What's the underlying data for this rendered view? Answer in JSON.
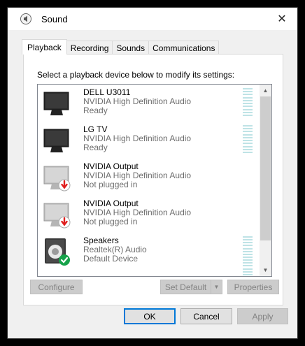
{
  "window": {
    "title": "Sound",
    "close_glyph": "✕"
  },
  "tabs": [
    {
      "label": "Playback",
      "active": true
    },
    {
      "label": "Recording"
    },
    {
      "label": "Sounds"
    },
    {
      "label": "Communications"
    }
  ],
  "instruction": "Select a playback device below to modify its settings:",
  "devices": [
    {
      "name": "DELL U3011",
      "driver": "NVIDIA High Definition Audio",
      "status": "Ready",
      "icon": "monitor-icon",
      "badge": ""
    },
    {
      "name": "LG TV",
      "driver": "NVIDIA High Definition Audio",
      "status": "Ready",
      "icon": "monitor-icon",
      "badge": ""
    },
    {
      "name": "NVIDIA Output",
      "driver": "NVIDIA High Definition Audio",
      "status": "Not plugged in",
      "icon": "monitor-unplugged-icon",
      "badge": "red-down-arrow"
    },
    {
      "name": "NVIDIA Output",
      "driver": "NVIDIA High Definition Audio",
      "status": "Not plugged in",
      "icon": "monitor-unplugged-icon",
      "badge": "red-down-arrow"
    },
    {
      "name": "Speakers",
      "driver": "Realtek(R) Audio",
      "status": "Default Device",
      "icon": "speaker-icon",
      "badge": "green-check"
    }
  ],
  "buttons": {
    "configure": "Configure",
    "set_default": "Set Default",
    "properties": "Properties",
    "ok": "OK",
    "cancel": "Cancel",
    "apply": "Apply"
  },
  "colors": {
    "accent": "#0078d7",
    "level_meter": "#bfe3e6",
    "check": "#16a34a",
    "unplugged": "#e01e1e"
  }
}
